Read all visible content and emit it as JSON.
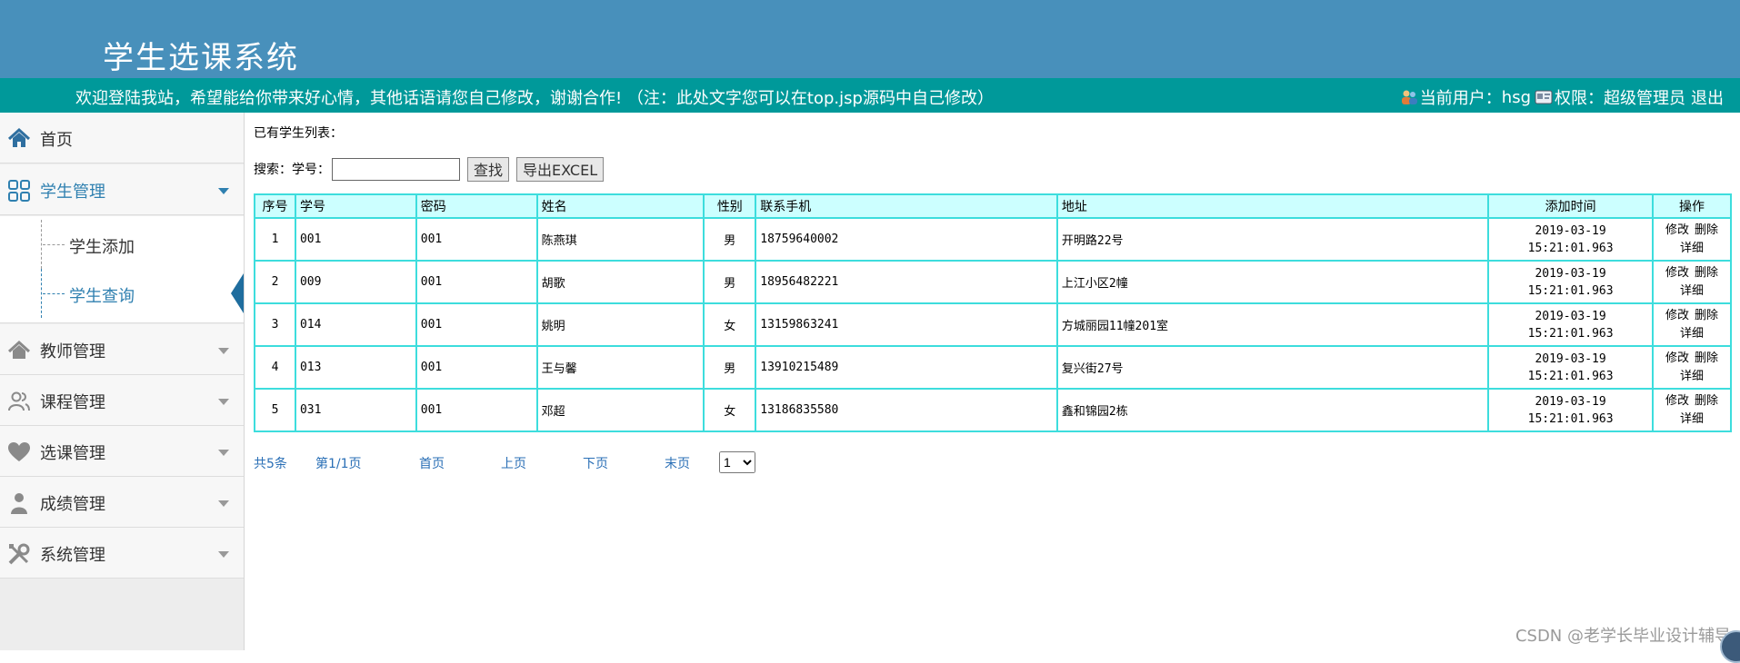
{
  "header": {
    "title": "学生选课系统",
    "welcome": "欢迎登陆我站，希望能给你带来好心情，其他话语请您自己修改，谢谢合作!  （注：此处文字您可以在top.jsp源码中自己修改）",
    "current_user_label": "当前用户：",
    "current_user": "hsg",
    "role_label": "权限：",
    "role": "超级管理员",
    "logout": "退出"
  },
  "sidebar": {
    "home": "首页",
    "groups": [
      {
        "label": "学生管理",
        "icon": "grid-icon",
        "expanded": true
      },
      {
        "label": "教师管理",
        "icon": "house-icon"
      },
      {
        "label": "课程管理",
        "icon": "people-icon"
      },
      {
        "label": "选课管理",
        "icon": "heart-icon"
      },
      {
        "label": "成绩管理",
        "icon": "person-icon"
      },
      {
        "label": "系统管理",
        "icon": "tools-icon"
      }
    ],
    "sub_items": [
      "学生添加",
      "学生查询"
    ],
    "active_sub_item": "学生查询"
  },
  "main": {
    "list_title": "已有学生列表：",
    "search_label": "搜索：学号：",
    "search_value": "",
    "search_button": "查找",
    "export_button": "导出EXCEL",
    "columns": [
      "序号",
      "学号",
      "密码",
      "姓名",
      "性别",
      "联系手机",
      "地址",
      "添加时间",
      "操作"
    ],
    "rows": [
      {
        "no": "1",
        "id": "001",
        "password": "001",
        "name": "陈燕琪",
        "gender": "男",
        "phone": "18759640002",
        "address": "开明路22号",
        "date": "2019-03-19",
        "time": "15:21:01.963"
      },
      {
        "no": "2",
        "id": "009",
        "password": "001",
        "name": "胡歌",
        "gender": "男",
        "phone": "18956482221",
        "address": "上江小区2幢",
        "date": "2019-03-19",
        "time": "15:21:01.963"
      },
      {
        "no": "3",
        "id": "014",
        "password": "001",
        "name": "姚明",
        "gender": "女",
        "phone": "13159863241",
        "address": "方城丽园11幢201室",
        "date": "2019-03-19",
        "time": "15:21:01.963"
      },
      {
        "no": "4",
        "id": "013",
        "password": "001",
        "name": "王与馨",
        "gender": "男",
        "phone": "13910215489",
        "address": "复兴街27号",
        "date": "2019-03-19",
        "time": "15:21:01.963"
      },
      {
        "no": "5",
        "id": "031",
        "password": "001",
        "name": "邓超",
        "gender": "女",
        "phone": "13186835580",
        "address": "鑫和锦园2栋",
        "date": "2019-03-19",
        "time": "15:21:01.963"
      }
    ],
    "row_actions": {
      "edit": "修改",
      "delete": "删除",
      "detail": "详细"
    }
  },
  "pager": {
    "total": "共5条",
    "page": "第1/1页",
    "first": "首页",
    "prev": "上页",
    "next": "下页",
    "last": "末页",
    "selected_page": "1"
  },
  "watermark": "CSDN @老学长毕业设计辅导",
  "colors": {
    "banner": "#4890bb",
    "topbar": "#00999a",
    "accent": "#2f80b0",
    "table_border": "#3ddddd",
    "table_header": "#ccffff",
    "link": "#2a6fb6"
  }
}
